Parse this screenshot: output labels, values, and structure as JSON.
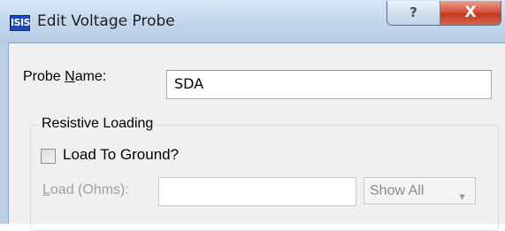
{
  "window": {
    "app_icon_text": "ISIS",
    "title": "Edit Voltage Probe",
    "help_symbol": "?",
    "close_symbol": "X"
  },
  "probe": {
    "name_label_pre": "Probe ",
    "name_label_accel": "N",
    "name_label_post": "ame:",
    "name_value": "SDA"
  },
  "resistive_loading": {
    "group_title": "Resistive Loading",
    "checkbox_label": "Load To Ground?",
    "checkbox_checked": false,
    "load_label_accel": "L",
    "load_label_post": "oad (Ohms):",
    "load_value": "",
    "select_value": "Show All",
    "select_arrow": "▼"
  }
}
